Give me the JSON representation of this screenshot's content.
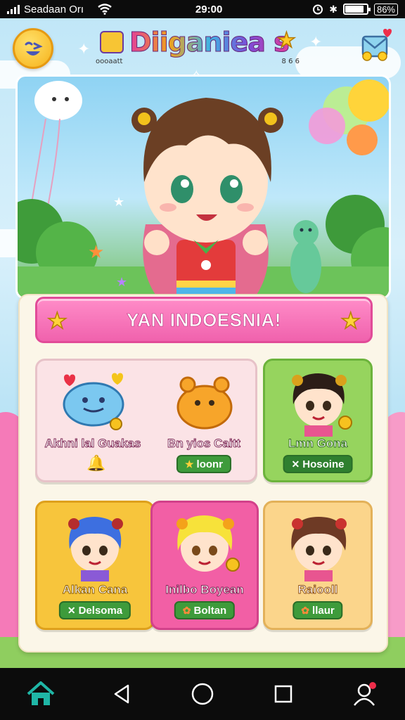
{
  "status_bar": {
    "carrier": "Seadaan Orı",
    "time": "29:00",
    "battery_text": "86%",
    "battery_level": 0.86
  },
  "header": {
    "title": "Diiganiea s",
    "sub_left": "oooaatt",
    "sub_right": "8 6 6",
    "emoji_icon": "smiley-emoji-icon",
    "mail_icon": "mail-heart-icon"
  },
  "banner": {
    "text": "YAN INDOESNIA!"
  },
  "cards": [
    {
      "label": "Akhni lal Guakas",
      "badge": "",
      "color": "#fbe3e6",
      "border": "#e7c2c8"
    },
    {
      "label": "Bn yios Caitt",
      "badge": "loonr",
      "color": "#fbe3e6",
      "border": "#e7c2c8"
    },
    {
      "label": "Lmn Gona",
      "badge": "Hosoine",
      "color": "#96d45e",
      "border": "#6cb33c"
    },
    {
      "label": "Alkan Cana",
      "badge": "Delsoma",
      "color": "#f7c53c",
      "border": "#dea01c"
    },
    {
      "label": "Inilbo Boyean",
      "badge": "Boltan",
      "color": "#f25fa5",
      "border": "#d2418a"
    },
    {
      "label": "Raiooll",
      "badge": "llaur",
      "color": "#fbd58b",
      "border": "#e3b159"
    }
  ],
  "nav": {
    "home": "home-icon",
    "back": "back-triangle-icon",
    "circle": "home-circle-icon",
    "recents": "recents-square-icon",
    "profile": "profile-icon"
  },
  "colors": {
    "accent_pink": "#f062ad",
    "accent_yellow": "#f7c53c",
    "accent_green": "#96d45e",
    "panel": "#fbf6e8"
  }
}
